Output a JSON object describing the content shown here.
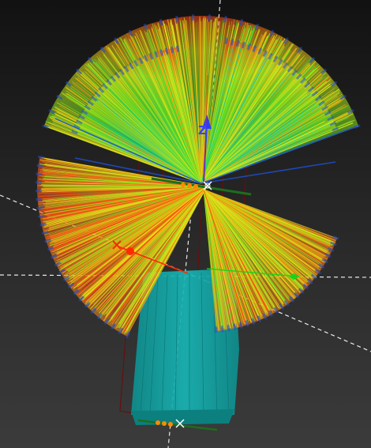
{
  "viewport": {
    "axis_labels": {
      "z": "Z",
      "x": "X"
    }
  },
  "colors": {
    "background_top": "#121212",
    "background_bottom": "#3b3b3b",
    "x_axis": "#ff2a00",
    "y_axis": "#18d418",
    "z_axis": "#2a3cff",
    "beam_cyan": "#12a3a3",
    "bounding_box": "#6a0d0d",
    "guide_line": "#ffffff",
    "ray_palette": [
      "#1f4fd0",
      "#16c8a0",
      "#2fdc2f",
      "#9be61e",
      "#e8e81a",
      "#f2a80f",
      "#ff4a14"
    ]
  }
}
